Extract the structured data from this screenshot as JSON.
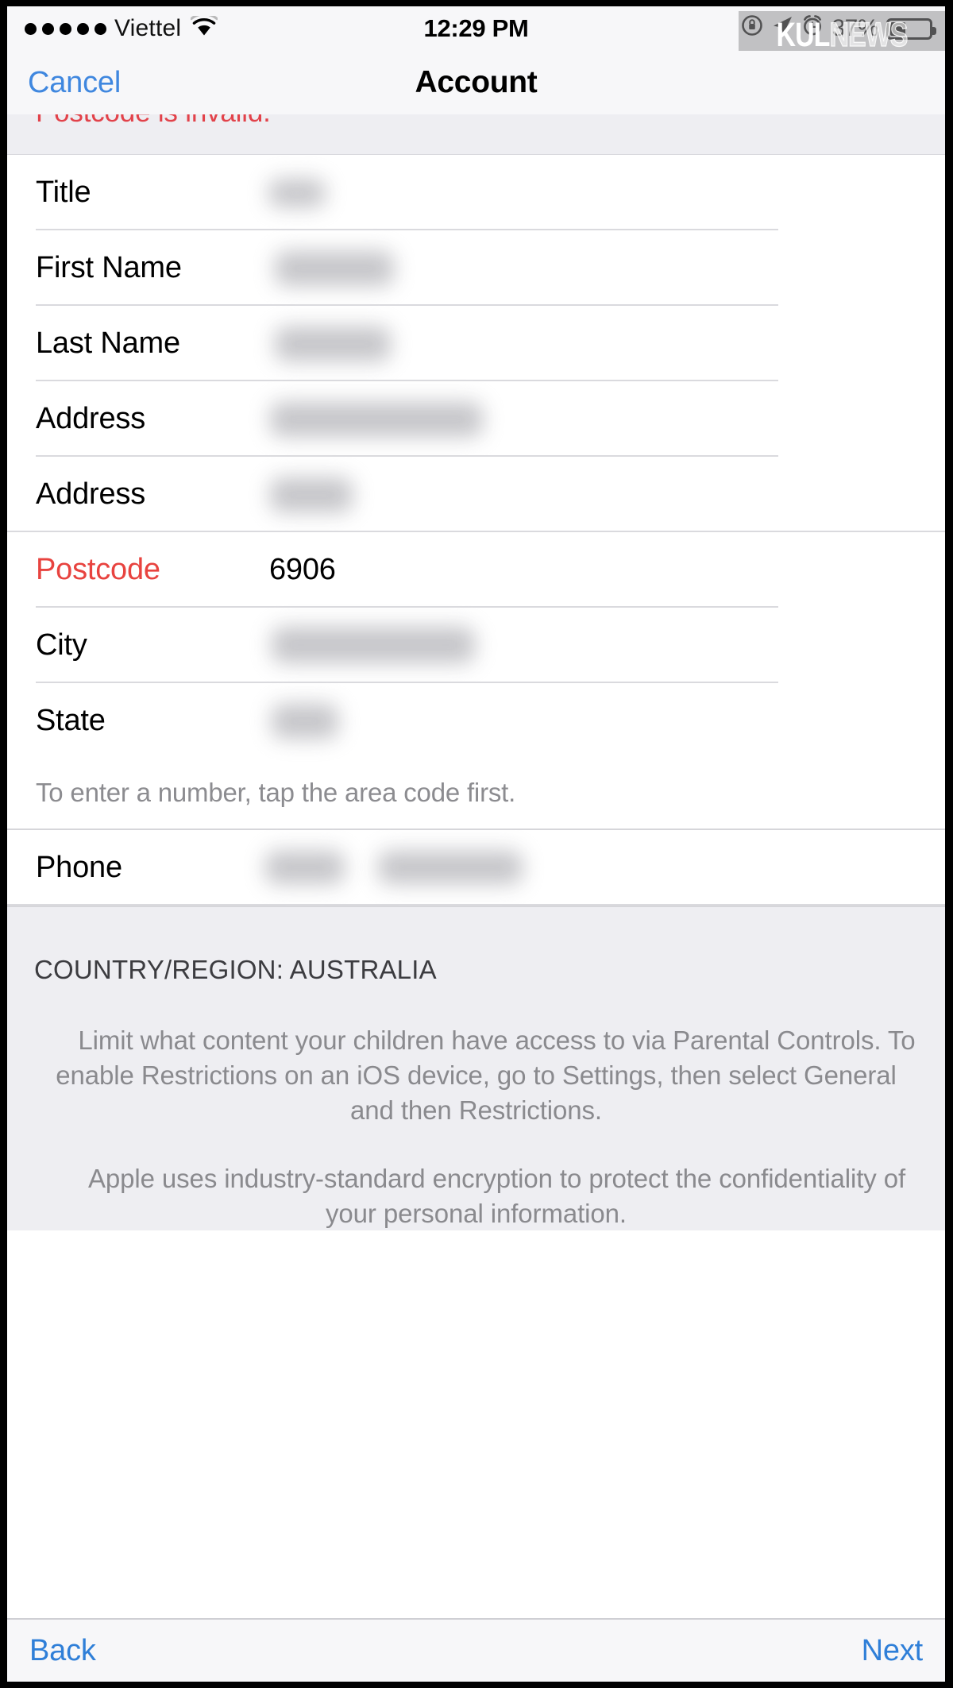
{
  "statusbar": {
    "carrier": "Viettel",
    "signal_dots": 5,
    "wifi_icon": "wifi-icon",
    "time": "12:29 PM",
    "icons": [
      "rotation-lock-icon",
      "location-arrow-icon",
      "alarm-clock-icon"
    ],
    "battery_percent": "37%",
    "battery_level": 37
  },
  "watermark": {
    "part_one": "KUL",
    "part_two": "NEWS"
  },
  "navbar": {
    "cancel_label": "Cancel",
    "title": "Account"
  },
  "error": {
    "message": "Postcode is invalid."
  },
  "form": {
    "rows": [
      {
        "label": "Title",
        "value": "",
        "redacted": true,
        "invalid": false,
        "sep": "inset"
      },
      {
        "label": "First Name",
        "value": "",
        "redacted": true,
        "invalid": false,
        "sep": "inset"
      },
      {
        "label": "Last Name",
        "value": "",
        "redacted": true,
        "invalid": false,
        "sep": "inset"
      },
      {
        "label": "Address",
        "value": "",
        "redacted": true,
        "invalid": false,
        "sep": "inset"
      },
      {
        "label": "Address",
        "value": "",
        "redacted": true,
        "invalid": false,
        "sep": "full"
      },
      {
        "label": "Postcode",
        "value": "6906",
        "redacted": false,
        "invalid": true,
        "sep": "inset"
      },
      {
        "label": "City",
        "value": "",
        "redacted": true,
        "invalid": false,
        "sep": "inset"
      },
      {
        "label": "State",
        "value": "",
        "redacted": true,
        "invalid": false,
        "sep": "none"
      }
    ],
    "hint": "To enter a number, tap the area code first.",
    "phone_row": {
      "label": "Phone",
      "value": "",
      "redacted": true
    }
  },
  "footer": {
    "country_line": "COUNTRY/REGION: AUSTRALIA",
    "paragraph_1": "Limit what content your children have access to via Parental Controls. To enable Restrictions on an iOS device, go to Settings, then select General and then Restrictions.",
    "paragraph_2": "Apple uses industry-standard encryption to protect the confidentiality of your personal information."
  },
  "toolbar": {
    "back_label": "Back",
    "next_label": "Next"
  },
  "colors": {
    "accent_blue": "#2f7fd8",
    "nav_blue": "#3f87df",
    "error_red": "#e8433f",
    "bar_bg": "#f7f7f9",
    "section_bg": "#eeeef2",
    "separator": "#dadade"
  }
}
